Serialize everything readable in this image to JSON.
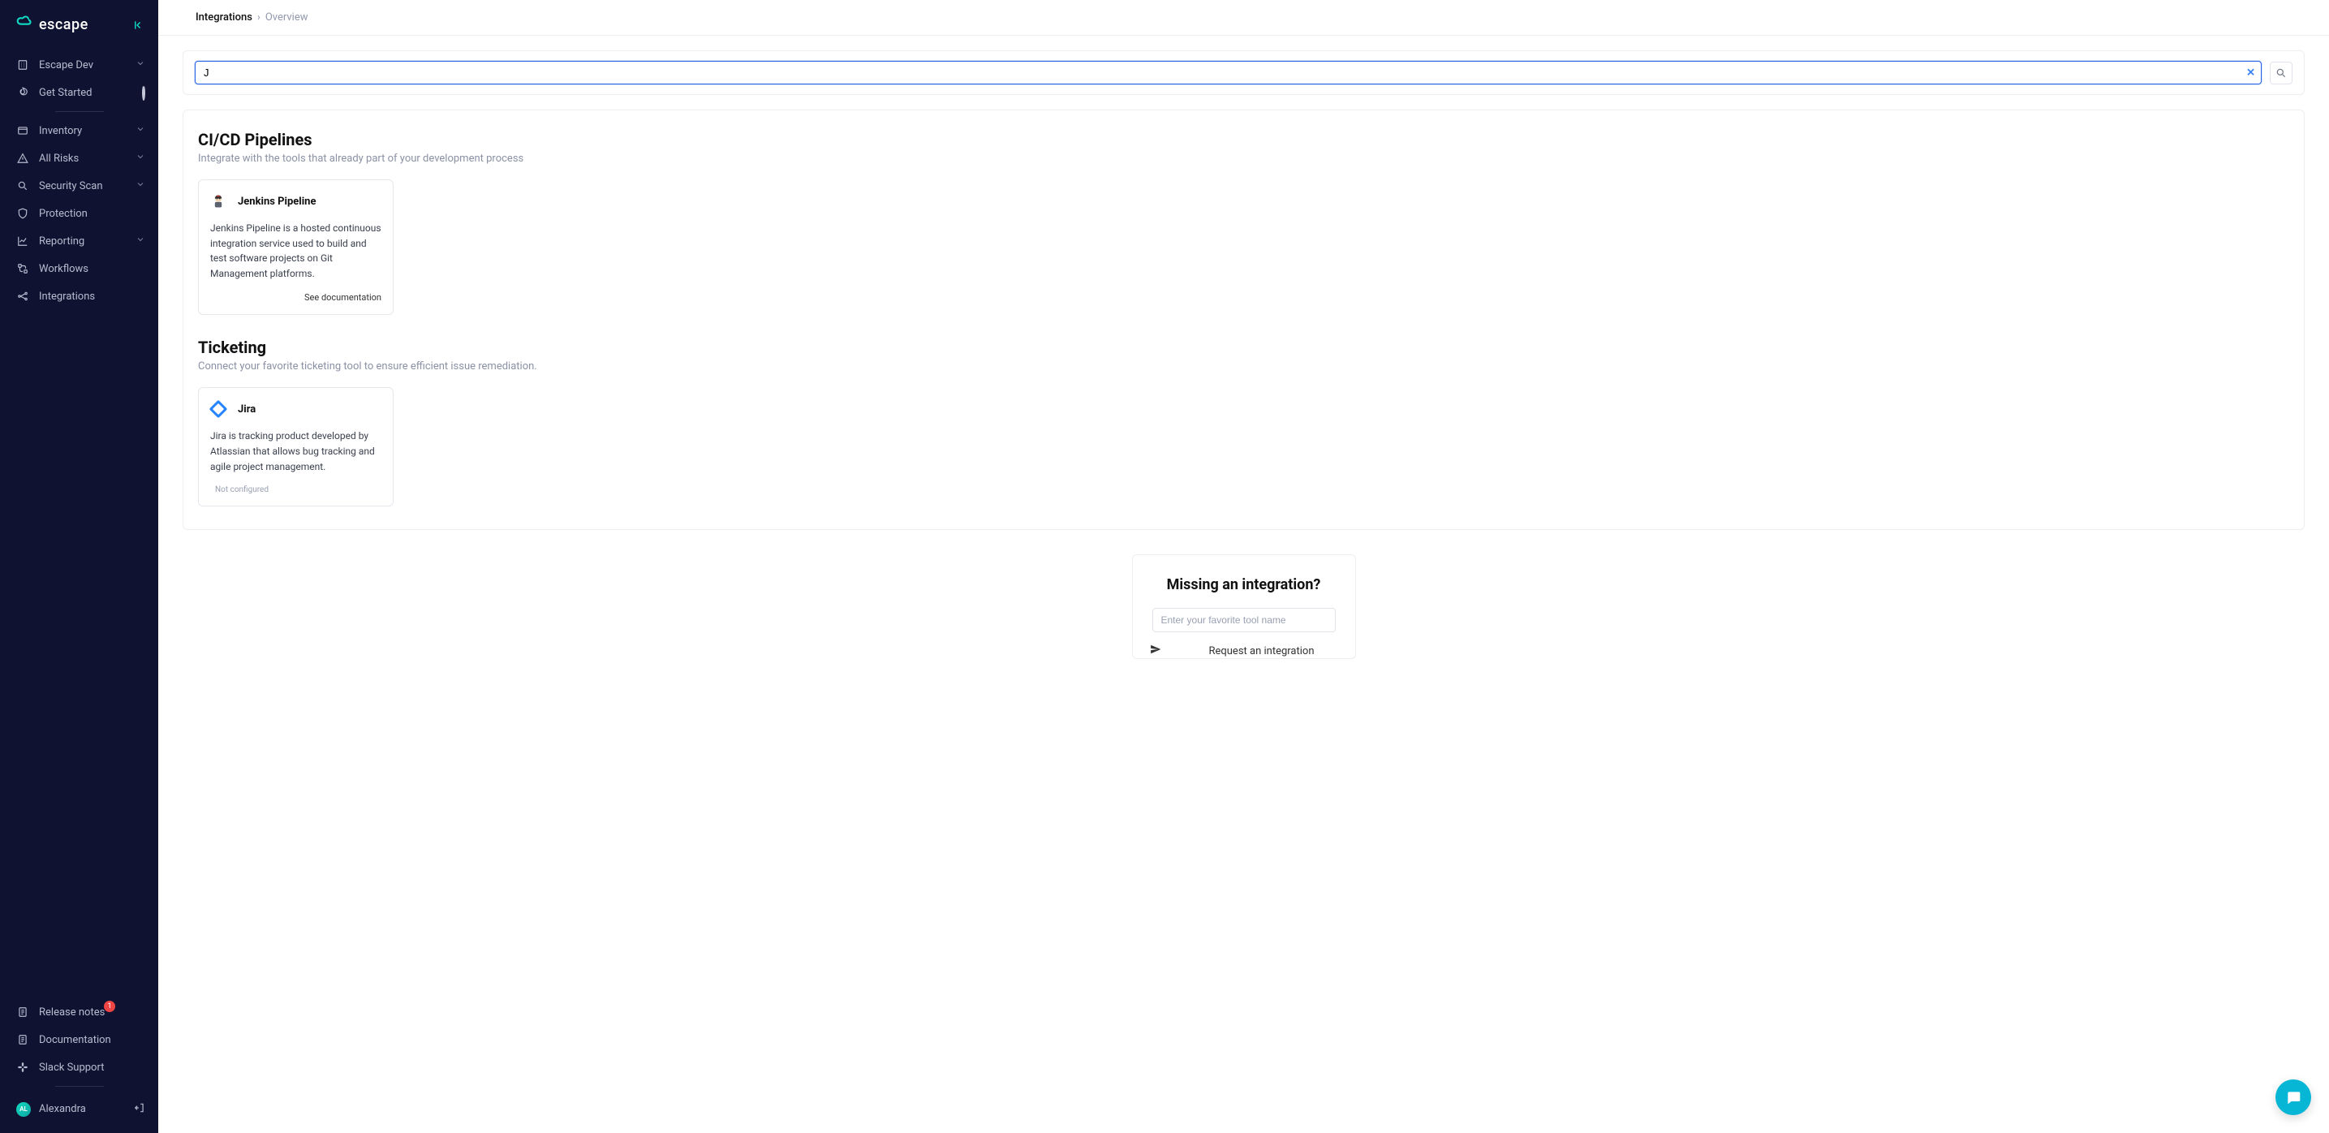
{
  "brand": "escape",
  "breadcrumb": {
    "root": "Integrations",
    "current": "Overview"
  },
  "search": {
    "value": "J"
  },
  "sidebar": {
    "org": "Escape Dev",
    "items": [
      {
        "label": "Get Started",
        "icon": "flame"
      },
      {
        "label": "Inventory",
        "icon": "browser",
        "expandable": true
      },
      {
        "label": "All Risks",
        "icon": "warning",
        "expandable": true
      },
      {
        "label": "Security Scan",
        "icon": "search",
        "expandable": true
      },
      {
        "label": "Protection",
        "icon": "shield"
      },
      {
        "label": "Reporting",
        "icon": "chart",
        "expandable": true
      },
      {
        "label": "Workflows",
        "icon": "nodes"
      },
      {
        "label": "Integrations",
        "icon": "network"
      }
    ],
    "footer": [
      {
        "label": "Release notes",
        "icon": "doc",
        "badge": "1"
      },
      {
        "label": "Documentation",
        "icon": "doc"
      },
      {
        "label": "Slack Support",
        "icon": "slack"
      }
    ],
    "user": {
      "name": "Alexandra",
      "initials": "AL"
    }
  },
  "sections": [
    {
      "title": "CI/CD Pipelines",
      "subtitle": "Integrate with the tools that already part of your development process",
      "cards": [
        {
          "name": "Jenkins Pipeline",
          "description": "Jenkins Pipeline is a hosted continuous integration service used to build and test software projects on Git Management platforms.",
          "footer": "See documentation",
          "footer_type": "link",
          "icon": "jenkins"
        }
      ]
    },
    {
      "title": "Ticketing",
      "subtitle": "Connect your favorite ticketing tool to ensure efficient issue remediation.",
      "cards": [
        {
          "name": "Jira",
          "description": "Jira is tracking product developed by Atlassian that allows bug tracking and agile project management.",
          "footer": "Not configured",
          "footer_type": "muted",
          "icon": "jira"
        }
      ]
    }
  ],
  "missing": {
    "title": "Missing an integration?",
    "placeholder": "Enter your favorite tool name",
    "button": "Request an integration"
  }
}
